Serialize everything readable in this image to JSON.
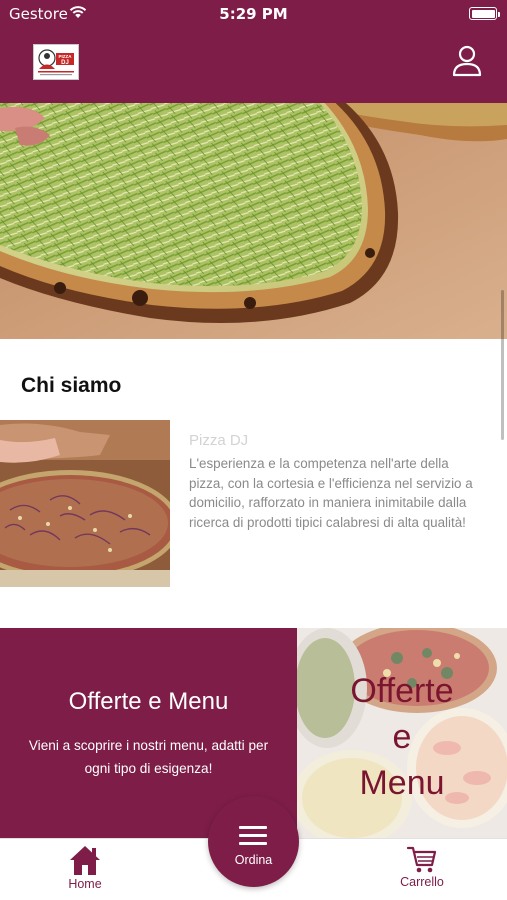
{
  "status_bar": {
    "carrier": "Gestore",
    "time": "5:29 PM"
  },
  "header": {
    "logo_text": "PIZZA DJ",
    "logo_small_text": "PIZZA DJ"
  },
  "about": {
    "title": "Chi siamo",
    "name": "Pizza DJ",
    "description": "L'esperienza e la competenza nell'arte della pizza, con la cortesia e l'efficienza nel servizio a domicilio, rafforzato in maniera inimitabile dalla ricerca di prodotti tipici calabresi di alta qualità!"
  },
  "offers": {
    "title": "Offerte e Menu",
    "subtitle": "Vieni a scoprire i nostri menu, adatti per ogni tipo di esigenza!",
    "image_text_line1": "Offerte",
    "image_text_line2": "e",
    "image_text_line3": "Menu"
  },
  "tabbar": {
    "home_label": "Home",
    "order_label": "Ordina",
    "cart_label": "Carrello"
  },
  "colors": {
    "brand": "#7d1d48",
    "offer_text": "#7a1530"
  },
  "icons": [
    "wifi-icon",
    "battery-icon",
    "user-icon",
    "home-icon",
    "menu-icon",
    "cart-icon"
  ]
}
